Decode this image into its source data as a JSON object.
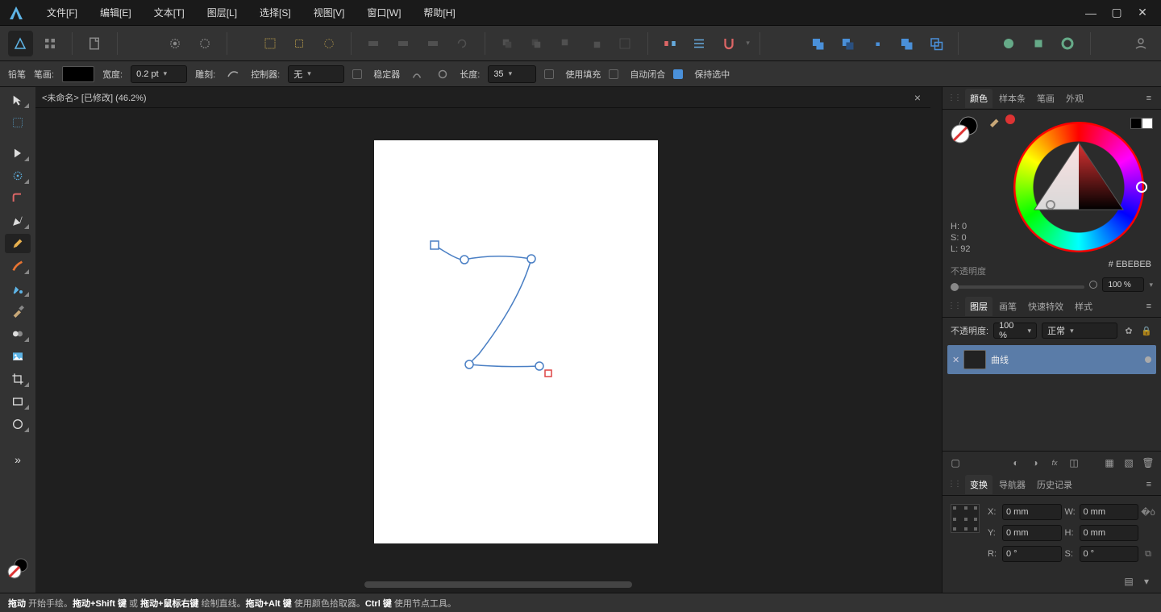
{
  "menu": {
    "items": [
      "文件[F]",
      "编辑[E]",
      "文本[T]",
      "图层[L]",
      "选择[S]",
      "视图[V]",
      "窗口[W]",
      "帮助[H]"
    ]
  },
  "context_toolbar": {
    "tool_name": "铅笔",
    "stroke_label": "笔画:",
    "width_label": "宽度:",
    "width_value": "0.2 pt",
    "carve_label": "雕刻:",
    "controller_label": "控制器:",
    "controller_value": "无",
    "stabilizer_label": "稳定器",
    "length_label": "长度:",
    "length_value": "35",
    "use_fill_label": "使用填充",
    "auto_close_label": "自动闭合",
    "keep_selected_label": "保持选中"
  },
  "document": {
    "tab_title": "<未命名> [已修改] (46.2%)"
  },
  "panels": {
    "color": {
      "tabs": [
        "颜色",
        "样本条",
        "笔画",
        "外观"
      ],
      "h_label": "H: 0",
      "s_label": "S: 0",
      "l_label": "L: 92",
      "hex_prefix": "#",
      "hex_value": "EBEBEB",
      "opacity_label": "不透明度",
      "opacity_value": "100 %"
    },
    "layers": {
      "tabs": [
        "图层",
        "画笔",
        "快速特效",
        "样式"
      ],
      "opacity_label": "不透明度:",
      "opacity_value": "100 %",
      "blend_value": "正常",
      "item_name": "曲线"
    },
    "transform": {
      "tabs": [
        "变换",
        "导航器",
        "历史记录"
      ],
      "x_label": "X:",
      "x_value": "0 mm",
      "y_label": "Y:",
      "y_value": "0 mm",
      "w_label": "W:",
      "w_value": "0 mm",
      "h_label": "H:",
      "h_value": "0 mm",
      "r_label": "R:",
      "r_value": "0 °",
      "s_label": "S:",
      "s_value": "0 °"
    }
  },
  "statusbar": {
    "seg1a": "拖动",
    "seg1b": " 开始手绘。",
    "seg2a": "拖动+Shift 键",
    "seg2b": " 或 ",
    "seg2c": "拖动+鼠标右键",
    "seg2d": " 绘制直线。",
    "seg3a": "拖动+Alt 键",
    "seg3b": " 使用颜色拾取器。",
    "seg4a": "Ctrl 键",
    "seg4b": " 使用节点工具。"
  }
}
